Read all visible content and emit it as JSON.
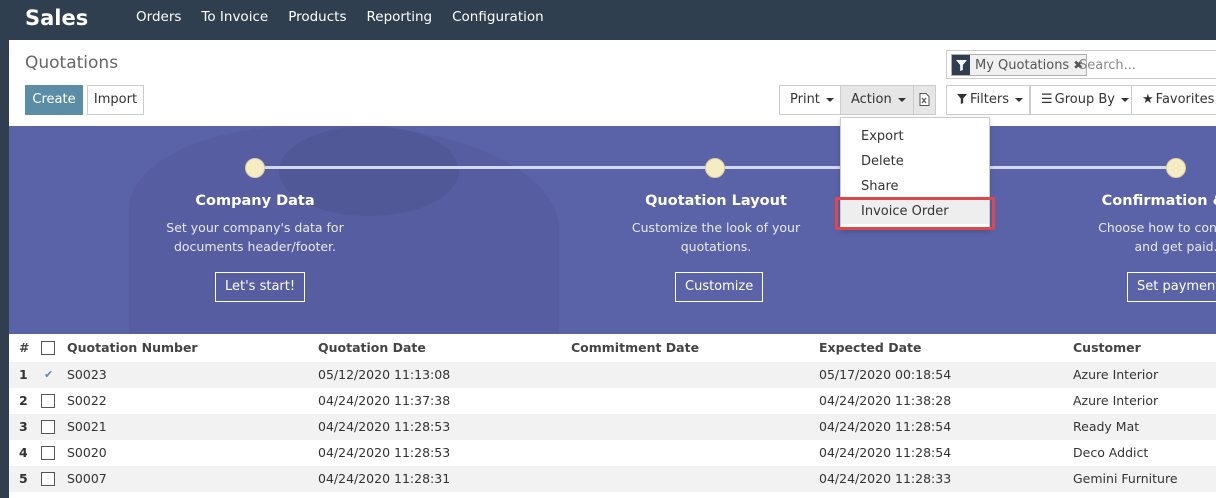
{
  "app": {
    "brand": "Sales",
    "menu": [
      "Orders",
      "To Invoice",
      "Products",
      "Reporting",
      "Configuration"
    ]
  },
  "control_panel": {
    "title": "Quotations",
    "create_label": "Create",
    "import_label": "Import",
    "print_label": "Print",
    "action_label": "Action",
    "filters_label": "Filters",
    "groupby_label": "Group By",
    "favorites_label": "Favorites",
    "search": {
      "facet_label": "My Quotations",
      "facet_remove": "✖",
      "placeholder": "Search..."
    }
  },
  "action_menu": {
    "items": [
      "Export",
      "Delete",
      "Share",
      "Invoice Order"
    ],
    "highlighted": "Invoice Order"
  },
  "onboarding": {
    "steps": [
      {
        "title": "Company Data",
        "desc1": "Set your company's data for",
        "desc2": "documents header/footer.",
        "button": "Let's start!"
      },
      {
        "title": "Quotation Layout",
        "desc1": "Customize the look of your",
        "desc2": "quotations.",
        "button": "Customize"
      },
      {
        "title": "Confirmation & Pa",
        "desc1": "Choose how to confirm q",
        "desc2": "and get paid.",
        "button": "Set payments"
      }
    ]
  },
  "table": {
    "headers": {
      "index": "#",
      "number": "Quotation Number",
      "date": "Quotation Date",
      "commitment": "Commitment Date",
      "expected": "Expected Date",
      "customer": "Customer"
    },
    "rows": [
      {
        "index": "1",
        "number": "S0023",
        "date": "05/12/2020 11:13:08",
        "commitment": "",
        "expected": "05/17/2020 00:18:54",
        "customer": "Azure Interior"
      },
      {
        "index": "2",
        "number": "S0022",
        "date": "04/24/2020 11:37:38",
        "commitment": "",
        "expected": "04/24/2020 11:38:28",
        "customer": "Azure Interior"
      },
      {
        "index": "3",
        "number": "S0021",
        "date": "04/24/2020 11:28:53",
        "commitment": "",
        "expected": "04/24/2020 11:28:54",
        "customer": "Ready Mat"
      },
      {
        "index": "4",
        "number": "S0020",
        "date": "04/24/2020 11:28:53",
        "commitment": "",
        "expected": "04/24/2020 11:28:54",
        "customer": "Deco Addict"
      },
      {
        "index": "5",
        "number": "S0007",
        "date": "04/24/2020 11:28:31",
        "commitment": "",
        "expected": "04/24/2020 11:28:33",
        "customer": "Gemini Furniture"
      }
    ]
  },
  "colors": {
    "navbar": "#2f3f4f",
    "primary": "#5b8ea6",
    "banner": "#5b63a8",
    "highlight_box": "#e0474c"
  }
}
